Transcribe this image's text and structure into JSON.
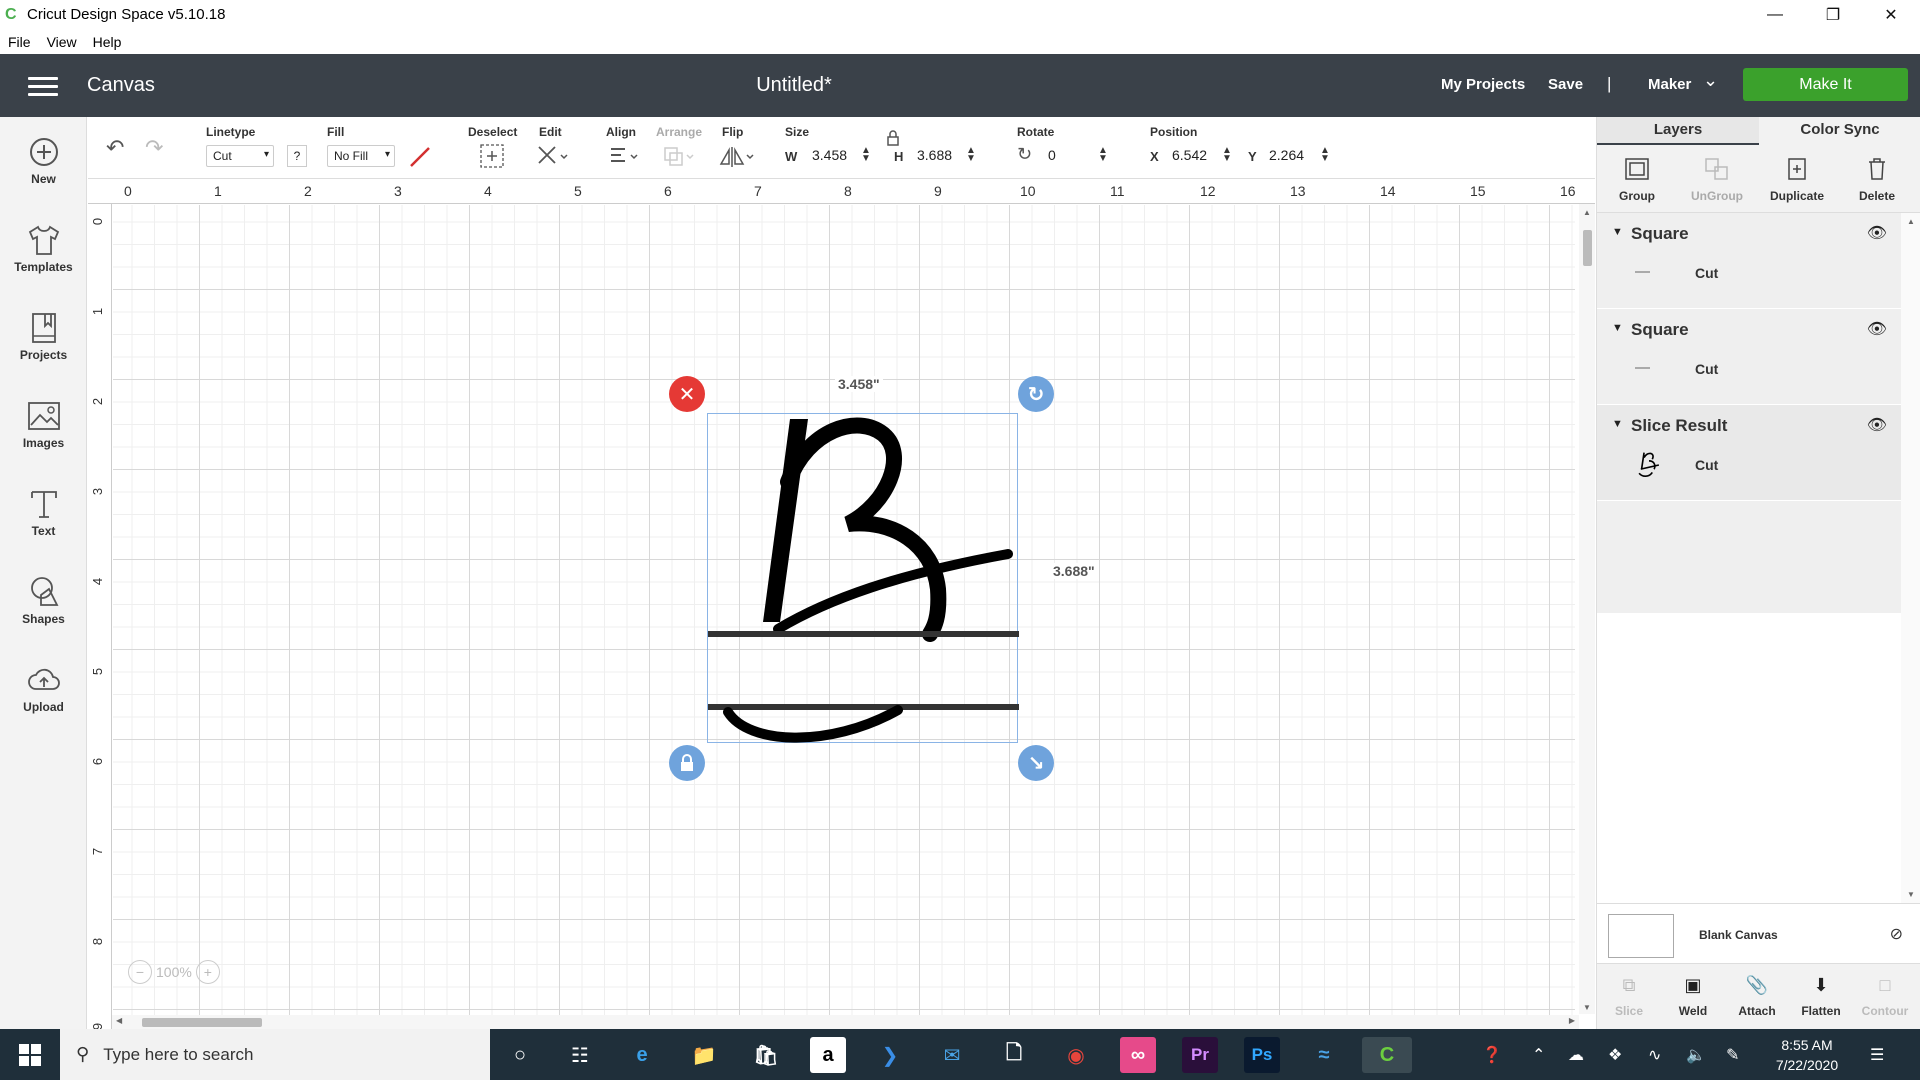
{
  "titlebar": {
    "title": "Cricut Design Space  v5.10.18"
  },
  "menubar": {
    "items": [
      "File",
      "View",
      "Help"
    ]
  },
  "header": {
    "section": "Canvas",
    "document_title": "Untitled*",
    "my_projects": "My Projects",
    "save": "Save",
    "separator": "|",
    "machine": "Maker",
    "make_it": "Make It",
    "accent": "#3ba12c"
  },
  "leftbar": {
    "items": [
      {
        "label": "New",
        "icon": "plus-circle-icon"
      },
      {
        "label": "Templates",
        "icon": "shirt-icon"
      },
      {
        "label": "Projects",
        "icon": "bookmark-icon"
      },
      {
        "label": "Images",
        "icon": "image-icon"
      },
      {
        "label": "Text",
        "icon": "text-icon"
      },
      {
        "label": "Shapes",
        "icon": "shapes-icon"
      },
      {
        "label": "Upload",
        "icon": "cloud-upload-icon"
      }
    ]
  },
  "toolbar": {
    "linetype_label": "Linetype",
    "linetype_value": "Cut",
    "help": "?",
    "fill_label": "Fill",
    "fill_value": "No Fill",
    "deselect_label": "Deselect",
    "edit_label": "Edit",
    "align_label": "Align",
    "arrange_label": "Arrange",
    "flip_label": "Flip",
    "size_label": "Size",
    "w_label": "W",
    "w_value": "3.458",
    "h_label": "H",
    "h_value": "3.688",
    "rotate_label": "Rotate",
    "rotate_value": "0",
    "position_label": "Position",
    "x_label": "X",
    "x_value": "6.542",
    "y_label": "Y",
    "y_value": "2.264"
  },
  "canvas": {
    "ruler_top": [
      "0",
      "1",
      "2",
      "3",
      "4",
      "5",
      "6",
      "7",
      "8",
      "9",
      "10",
      "11",
      "12",
      "13",
      "14",
      "15",
      "16"
    ],
    "ruler_left": [
      "0",
      "1",
      "2",
      "3",
      "4",
      "5",
      "6",
      "7",
      "8",
      "9"
    ],
    "width_label": "3.458\"",
    "height_label": "3.688\"",
    "zoom": "100%",
    "handle_delete_color": "#e53935",
    "handle_blue_color": "#6fa3dc"
  },
  "panel": {
    "tabs": [
      "Layers",
      "Color Sync"
    ],
    "tools": [
      "Group",
      "UnGroup",
      "Duplicate",
      "Delete"
    ],
    "layers": [
      {
        "name": "Square",
        "op": "Cut"
      },
      {
        "name": "Square",
        "op": "Cut"
      },
      {
        "name": "Slice Result",
        "op": "Cut"
      }
    ],
    "blank_canvas": "Blank Canvas",
    "bottom_tools": [
      "Slice",
      "Weld",
      "Attach",
      "Flatten",
      "Contour"
    ]
  },
  "taskbar": {
    "search_placeholder": "Type here to search",
    "time": "8:55 AM",
    "date": "7/22/2020"
  }
}
